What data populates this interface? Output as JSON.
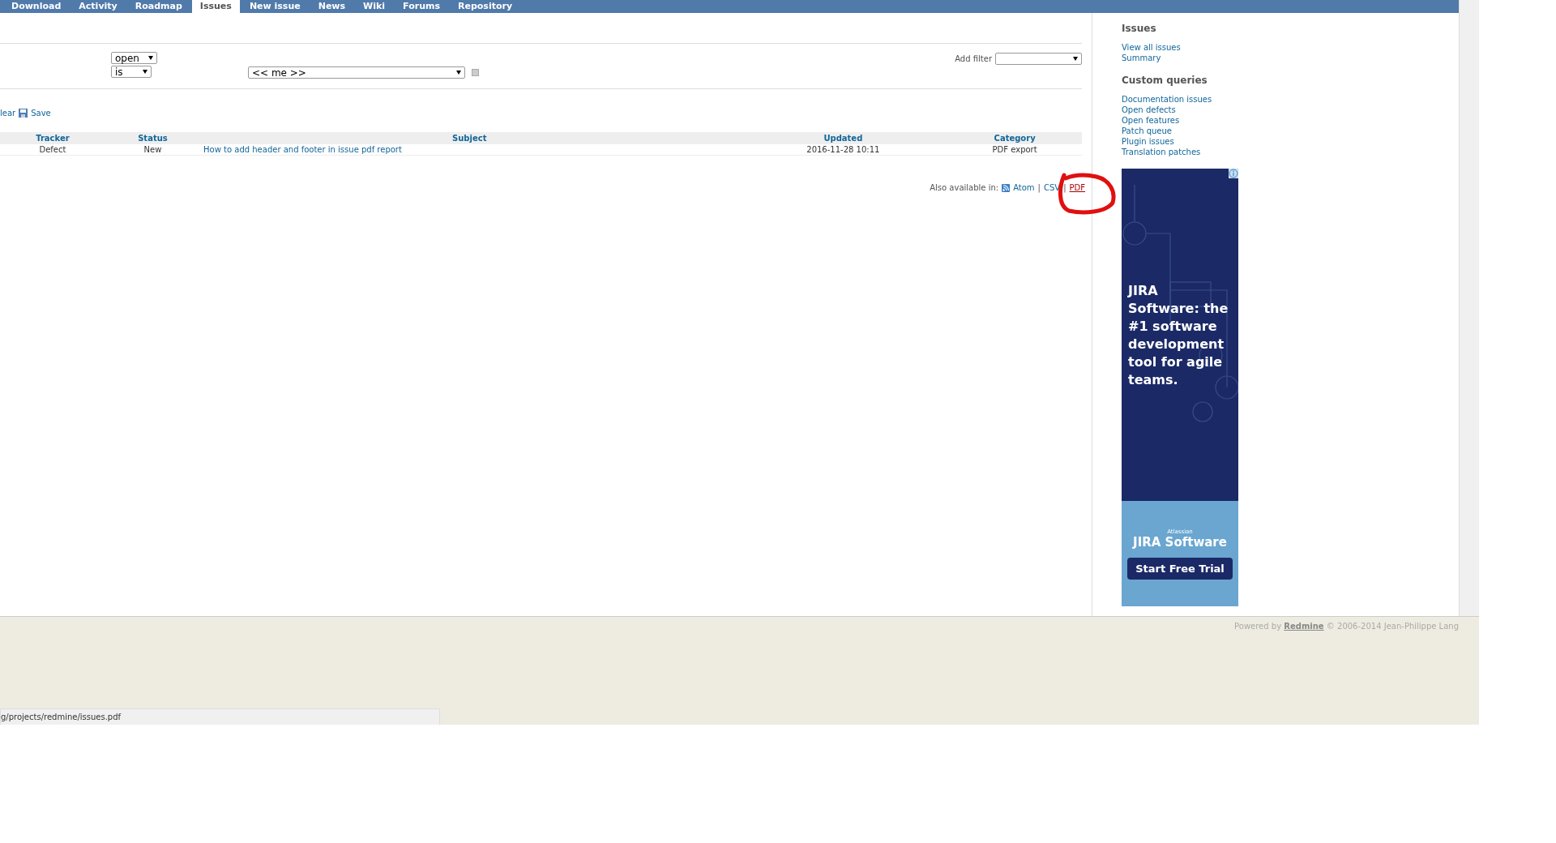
{
  "tabs": [
    {
      "label": "Download",
      "selected": false
    },
    {
      "label": "Activity",
      "selected": false
    },
    {
      "label": "Roadmap",
      "selected": false
    },
    {
      "label": "Issues",
      "selected": true
    },
    {
      "label": "New issue",
      "selected": false
    },
    {
      "label": "News",
      "selected": false
    },
    {
      "label": "Wiki",
      "selected": false
    },
    {
      "label": "Forums",
      "selected": false
    },
    {
      "label": "Repository",
      "selected": false
    }
  ],
  "filters": {
    "status_value": "open",
    "operator": "is",
    "assignee_value": "<< me >>",
    "add_filter_label": "Add filter"
  },
  "query_actions": [
    {
      "label": "lear",
      "kind": "link"
    },
    {
      "label": "Save",
      "kind": "save"
    }
  ],
  "table": {
    "columns": [
      "Tracker",
      "Status",
      "Subject",
      "Updated",
      "Category"
    ],
    "rows": [
      [
        "Defect",
        "New",
        "How to add header and footer in issue pdf report",
        "2016-11-28 10:11",
        "PDF export"
      ]
    ]
  },
  "export": {
    "label": "Also available in:",
    "separator": "|",
    "formats": [
      {
        "label": "Atom",
        "kind": "feed"
      },
      {
        "label": "CSV",
        "kind": "plain"
      },
      {
        "label": "PDF",
        "kind": "highlighted"
      }
    ]
  },
  "sidebar": {
    "issues_heading": "Issues",
    "issues_links": [
      "View all issues",
      "Summary"
    ],
    "queries_heading": "Custom queries",
    "queries_links": [
      "Documentation issues",
      "Open defects",
      "Open features",
      "Patch queue",
      "Plugin issues",
      "Translation patches"
    ]
  },
  "ad": {
    "headline": "JIRA Software: the #1 software development tool for agile teams.",
    "brand_small": "Atlassian",
    "brand": "JIRA Software",
    "cta": "Start Free Trial"
  },
  "footer": {
    "prefix": "Powered by",
    "link": "Redmine",
    "suffix": "© 2006-2014 Jean-Philippe Lang"
  },
  "status_bar": "g/projects/redmine/issues.pdf"
}
